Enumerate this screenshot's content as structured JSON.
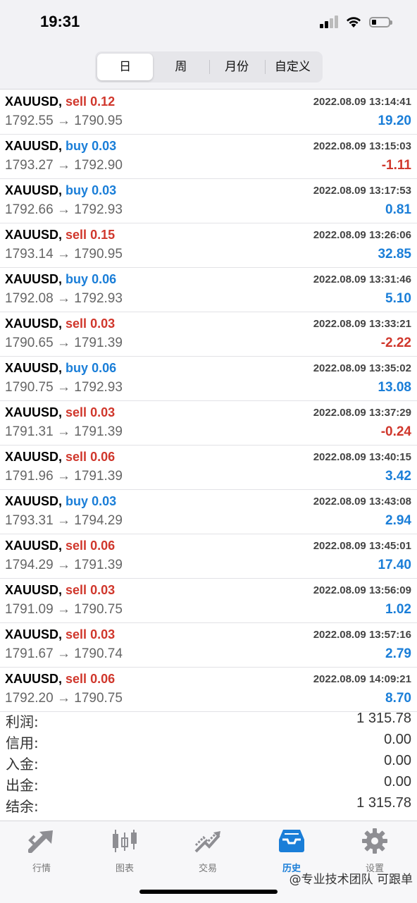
{
  "status": {
    "time": "19:31"
  },
  "tabs": [
    {
      "label": "日",
      "active": true
    },
    {
      "label": "周",
      "active": false
    },
    {
      "label": "月份",
      "active": false
    },
    {
      "label": "自定义",
      "active": false
    }
  ],
  "trades": [
    {
      "symbol": "XAUUSD,",
      "side": "sell",
      "volume": "0.12",
      "open": "1792.55",
      "close": "1790.95",
      "arrow": "→",
      "time": "2022.08.09 13:14:41",
      "profit": "19.20"
    },
    {
      "symbol": "XAUUSD,",
      "side": "buy",
      "volume": "0.03",
      "open": "1793.27",
      "close": "1792.90",
      "arrow": "→",
      "time": "2022.08.09 13:15:03",
      "profit": "-1.11"
    },
    {
      "symbol": "XAUUSD,",
      "side": "buy",
      "volume": "0.03",
      "open": "1792.66",
      "close": "1792.93",
      "arrow": "→",
      "time": "2022.08.09 13:17:53",
      "profit": "0.81"
    },
    {
      "symbol": "XAUUSD,",
      "side": "sell",
      "volume": "0.15",
      "open": "1793.14",
      "close": "1790.95",
      "arrow": "→",
      "time": "2022.08.09 13:26:06",
      "profit": "32.85"
    },
    {
      "symbol": "XAUUSD,",
      "side": "buy",
      "volume": "0.06",
      "open": "1792.08",
      "close": "1792.93",
      "arrow": "→",
      "time": "2022.08.09 13:31:46",
      "profit": "5.10"
    },
    {
      "symbol": "XAUUSD,",
      "side": "sell",
      "volume": "0.03",
      "open": "1790.65",
      "close": "1791.39",
      "arrow": "→",
      "time": "2022.08.09 13:33:21",
      "profit": "-2.22"
    },
    {
      "symbol": "XAUUSD,",
      "side": "buy",
      "volume": "0.06",
      "open": "1790.75",
      "close": "1792.93",
      "arrow": "→",
      "time": "2022.08.09 13:35:02",
      "profit": "13.08"
    },
    {
      "symbol": "XAUUSD,",
      "side": "sell",
      "volume": "0.03",
      "open": "1791.31",
      "close": "1791.39",
      "arrow": "→",
      "time": "2022.08.09 13:37:29",
      "profit": "-0.24"
    },
    {
      "symbol": "XAUUSD,",
      "side": "sell",
      "volume": "0.06",
      "open": "1791.96",
      "close": "1791.39",
      "arrow": "→",
      "time": "2022.08.09 13:40:15",
      "profit": "3.42"
    },
    {
      "symbol": "XAUUSD,",
      "side": "buy",
      "volume": "0.03",
      "open": "1793.31",
      "close": "1794.29",
      "arrow": "→",
      "time": "2022.08.09 13:43:08",
      "profit": "2.94"
    },
    {
      "symbol": "XAUUSD,",
      "side": "sell",
      "volume": "0.06",
      "open": "1794.29",
      "close": "1791.39",
      "arrow": "→",
      "time": "2022.08.09 13:45:01",
      "profit": "17.40"
    },
    {
      "symbol": "XAUUSD,",
      "side": "sell",
      "volume": "0.03",
      "open": "1791.09",
      "close": "1790.75",
      "arrow": "→",
      "time": "2022.08.09 13:56:09",
      "profit": "1.02"
    },
    {
      "symbol": "XAUUSD,",
      "side": "sell",
      "volume": "0.03",
      "open": "1791.67",
      "close": "1790.74",
      "arrow": "→",
      "time": "2022.08.09 13:57:16",
      "profit": "2.79"
    },
    {
      "symbol": "XAUUSD,",
      "side": "sell",
      "volume": "0.06",
      "open": "1792.20",
      "close": "1790.75",
      "arrow": "→",
      "time": "2022.08.09 14:09:21",
      "profit": "8.70"
    }
  ],
  "summary": [
    {
      "label": "利润:",
      "value": "1 315.78"
    },
    {
      "label": "信用:",
      "value": "0.00"
    },
    {
      "label": "入金:",
      "value": "0.00"
    },
    {
      "label": "出金:",
      "value": "0.00"
    },
    {
      "label": "结余:",
      "value": "1 315.78"
    }
  ],
  "tabbar": [
    {
      "label": "行情",
      "icon": "quotes-arrow-icon",
      "active": false
    },
    {
      "label": "图表",
      "icon": "candlestick-chart-icon",
      "active": false
    },
    {
      "label": "交易",
      "icon": "trade-chart-icon",
      "active": false
    },
    {
      "label": "历史",
      "icon": "history-inbox-icon",
      "active": true
    },
    {
      "label": "设置",
      "icon": "gear-icon",
      "active": false
    }
  ],
  "watermark": "@专业技术团队 可跟单",
  "colors": {
    "sell": "#d0372c",
    "buy": "#1a7ed8",
    "positive": "#1a7ed8",
    "negative": "#d0372c",
    "active_tab": "#1a7ed8",
    "inactive_icon": "#8e8e93"
  }
}
